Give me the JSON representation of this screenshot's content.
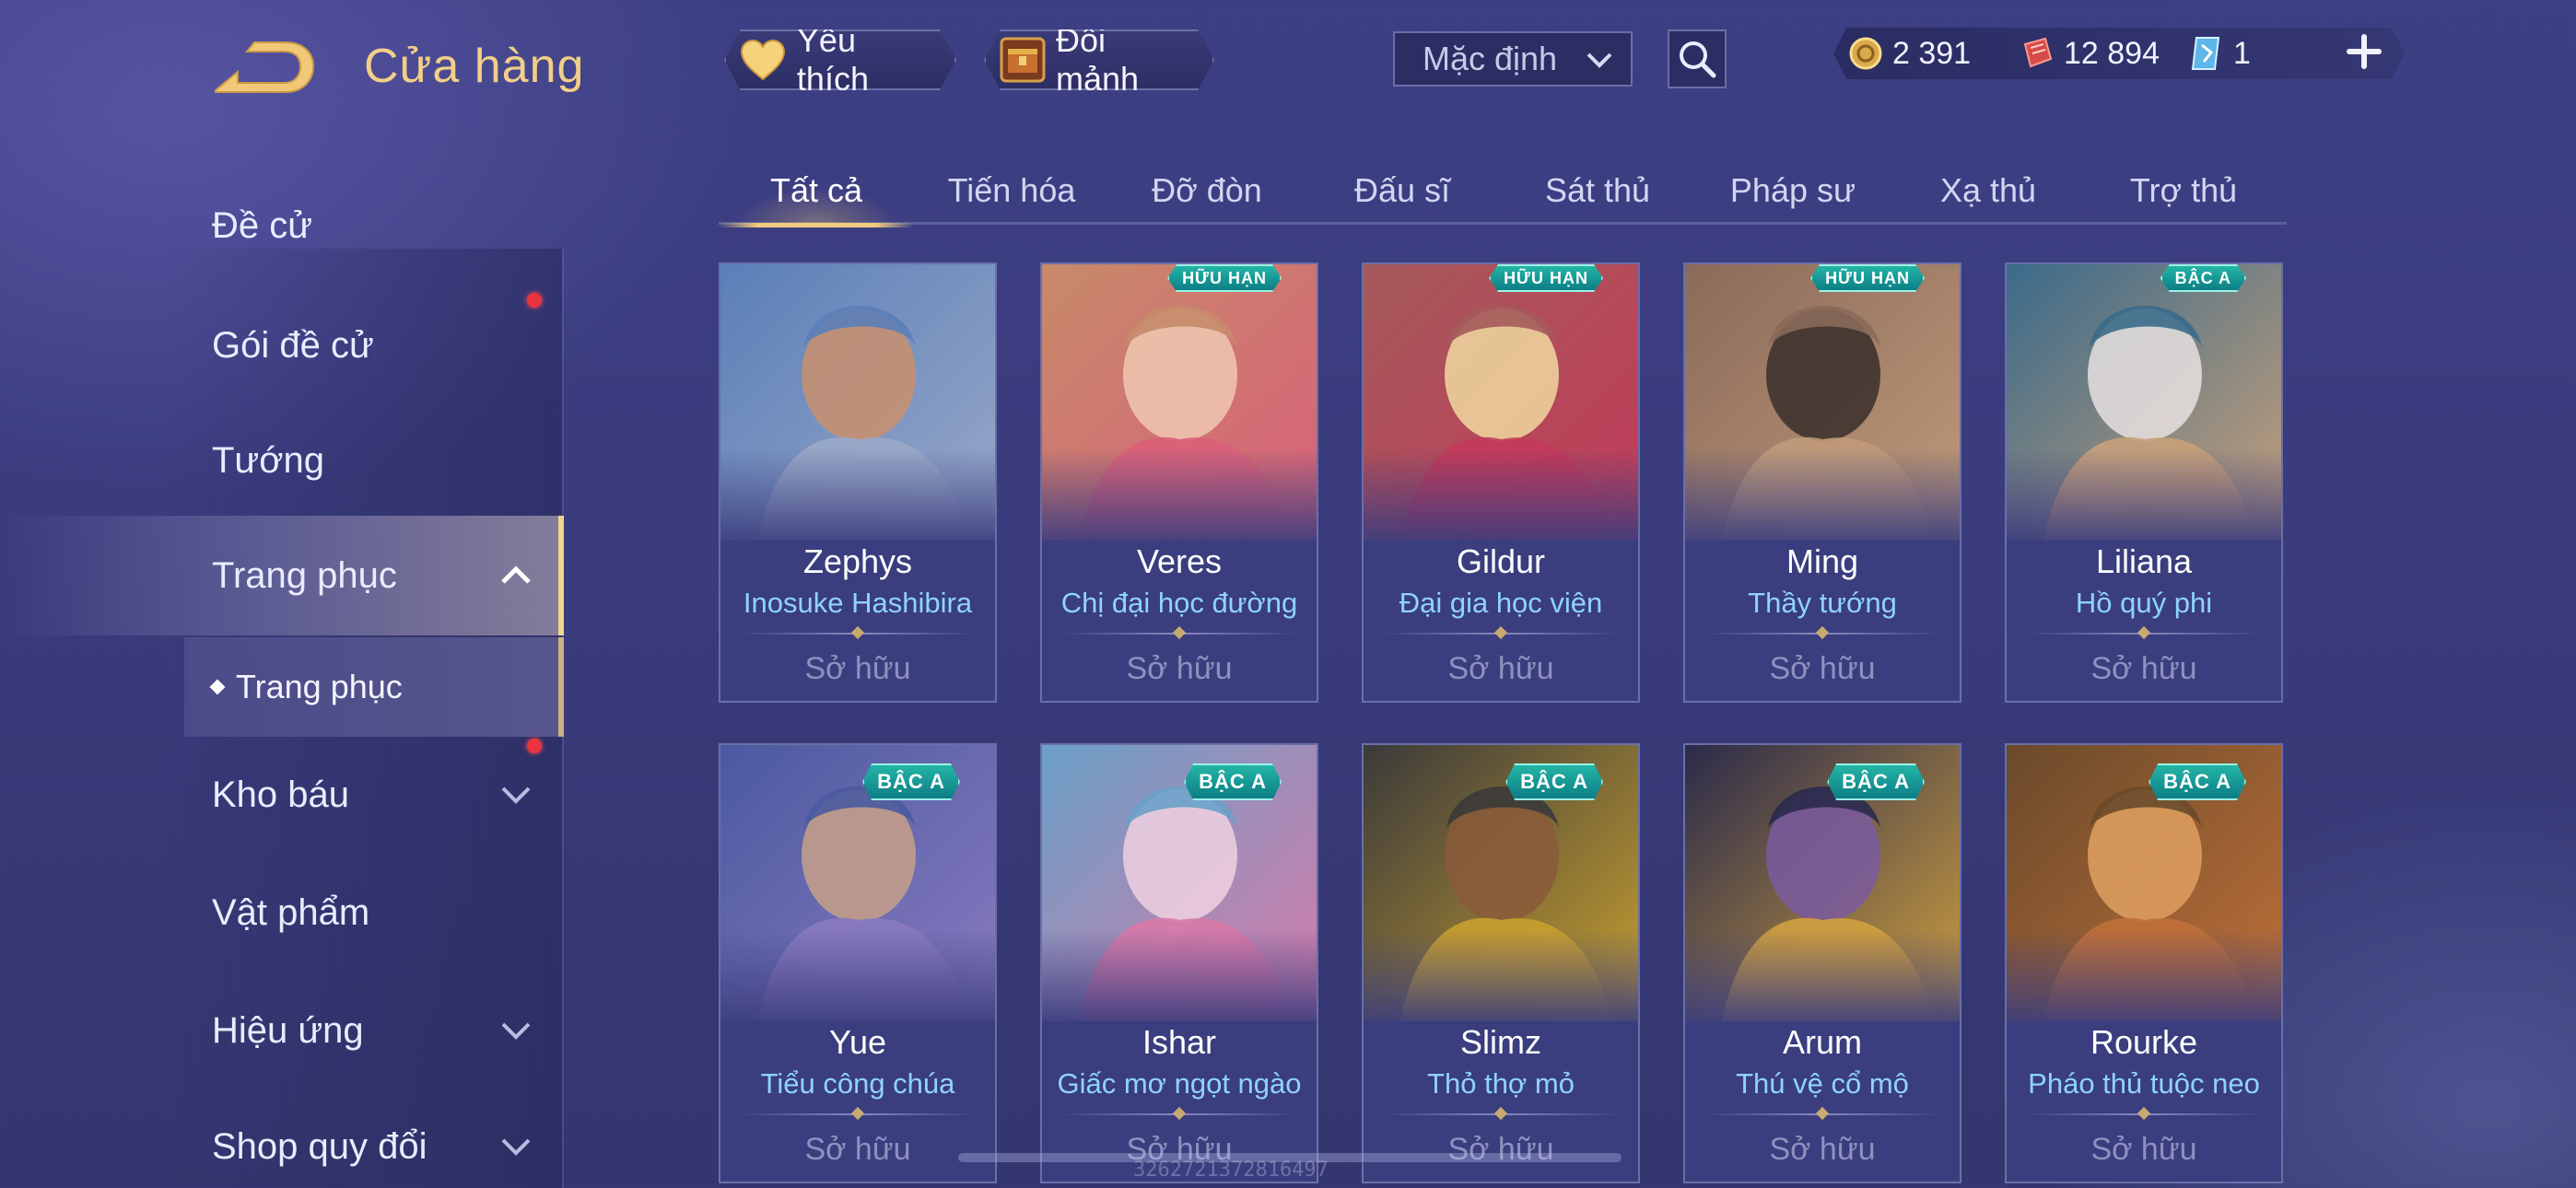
{
  "header": {
    "title": "Cửa hàng",
    "favorite_label": "Yêu thích",
    "fragment_label": "Đổi mảnh",
    "sort_selected": "Mặc định"
  },
  "currency": {
    "gold": "2 391",
    "voucher": "12 894",
    "gem": "1"
  },
  "sidebar": {
    "items": [
      {
        "label": "Đề cử"
      },
      {
        "label": "Gói đề cử"
      },
      {
        "label": "Tướng"
      },
      {
        "label": "Trang phục"
      },
      {
        "label": "Kho báu"
      },
      {
        "label": "Vật phẩm"
      },
      {
        "label": "Hiệu ứng"
      },
      {
        "label": "Shop quy đổi"
      }
    ],
    "sub_item": "Trang phục"
  },
  "tabs": [
    "Tất cả",
    "Tiến hóa",
    "Đỡ đòn",
    "Đấu sĩ",
    "Sát thủ",
    "Pháp sư",
    "Xạ thủ",
    "Trợ thủ"
  ],
  "cards": [
    {
      "hero": "Zephys",
      "skin": "Inosuke Hashibira",
      "status": "Sở hữu",
      "badge": "",
      "colors": [
        "#5a7fb8",
        "#9aa8c8",
        "#c98f6d"
      ]
    },
    {
      "hero": "Veres",
      "skin": "Chị đại học đường",
      "status": "Sở hữu",
      "badge": "HỮU HẠN",
      "colors": [
        "#c78a6a",
        "#d9607a",
        "#f0c8b0"
      ]
    },
    {
      "hero": "Gildur",
      "skin": "Đại gia học viện",
      "status": "Sở hữu",
      "badge": "HỮU HẠN",
      "colors": [
        "#a55a5a",
        "#c23a5a",
        "#f0d8a0"
      ]
    },
    {
      "hero": "Ming",
      "skin": "Thầy tướng",
      "status": "Sở hữu",
      "badge": "HỮU HẠN",
      "colors": [
        "#8a6a5a",
        "#c09a7a",
        "#3a2e2a"
      ]
    },
    {
      "hero": "Liliana",
      "skin": "Hồ quý phi",
      "status": "Sở hữu",
      "badge": "BẬC A",
      "colors": [
        "#3a6a8a",
        "#c8a07a",
        "#e8e0e0"
      ]
    },
    {
      "hero": "Yue",
      "skin": "Tiểu công chúa",
      "status": "Sở hữu",
      "badge": "BẬC A",
      "colors": [
        "#4a5aa0",
        "#8a7ac0",
        "#c8a088"
      ]
    },
    {
      "hero": "Ishar",
      "skin": "Giấc mơ ngọt ngào",
      "status": "Sở hữu",
      "badge": "BẬC A",
      "colors": [
        "#6aa0c8",
        "#d87aa8",
        "#f0d0e0"
      ]
    },
    {
      "hero": "Slimz",
      "skin": "Thỏ thợ mỏ",
      "status": "Sở hữu",
      "badge": "BẬC A",
      "colors": [
        "#3a3a3a",
        "#c8a030",
        "#8a5a3a"
      ]
    },
    {
      "hero": "Arum",
      "skin": "Thú vệ cổ mộ",
      "status": "Sở hữu",
      "badge": "BẬC A",
      "colors": [
        "#2a2a4a",
        "#d0a040",
        "#7a5aa0"
      ]
    },
    {
      "hero": "Rourke",
      "skin": "Pháo thủ tuộc neo",
      "status": "Sở hữu",
      "badge": "BẬC A",
      "colors": [
        "#6a4a2a",
        "#c0703a",
        "#e0a060"
      ]
    }
  ],
  "watermark": "3262721372816497"
}
